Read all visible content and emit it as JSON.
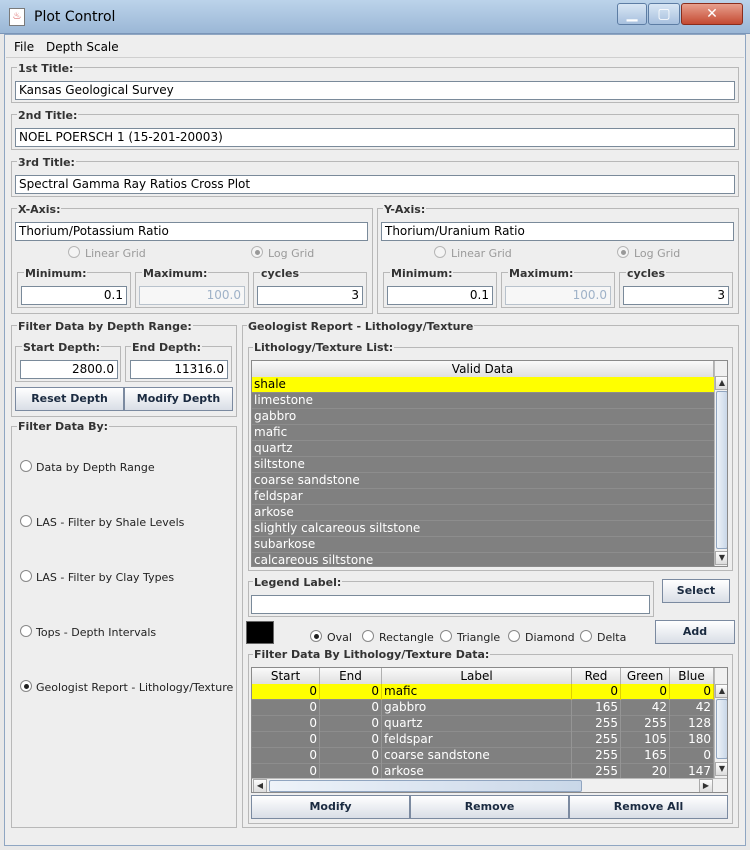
{
  "window": {
    "title": "Plot Control",
    "app_icon": "java-cup-icon",
    "minimize": "▁",
    "maximize": "▢",
    "close": "✕"
  },
  "menu": {
    "file": "File",
    "depth_scale": "Depth Scale"
  },
  "titles": {
    "t1_label": "1st Title:",
    "t1_value": "Kansas Geological Survey",
    "t2_label": "2nd Title:",
    "t2_value": "NOEL POERSCH 1 (15-201-20003)",
    "t3_label": "3rd Title:",
    "t3_value": "Spectral Gamma Ray Ratios Cross Plot"
  },
  "xaxis": {
    "label": "X-Axis:",
    "value": "Thorium/Potassium Ratio",
    "linear": "Linear Grid",
    "log": "Log Grid",
    "grid": "log",
    "min_label": "Minimum:",
    "min": "0.1",
    "max_label": "Maximum:",
    "max": "100.0",
    "cycles_label": "cycles",
    "cycles": "3"
  },
  "yaxis": {
    "label": "Y-Axis:",
    "value": "Thorium/Uranium Ratio",
    "linear": "Linear Grid",
    "log": "Log Grid",
    "grid": "log",
    "min_label": "Minimum:",
    "min": "0.1",
    "max_label": "Maximum:",
    "max": "100.0",
    "cycles_label": "cycles",
    "cycles": "3"
  },
  "depth": {
    "label": "Filter Data by Depth Range:",
    "start_label": "Start Depth:",
    "start": "2800.0",
    "end_label": "End Depth:",
    "end": "11316.0",
    "reset": "Reset Depth",
    "modify": "Modify Depth"
  },
  "filter_by": {
    "label": "Filter Data By:",
    "selected": 4,
    "options": [
      "Data by Depth Range",
      "LAS - Filter by Shale Levels",
      "LAS - Filter by Clay Types",
      "Tops - Depth Intervals",
      "Geologist Report - Lithology/Texture"
    ]
  },
  "geo": {
    "label": "Geologist Report - Lithology/Texture",
    "list_label": "Lithology/Texture List:",
    "list_header": "Valid Data",
    "list_items": [
      "shale",
      "limestone",
      "gabbro",
      "mafic",
      "quartz",
      "siltstone",
      "coarse sandstone",
      "feldspar",
      "arkose",
      "slightly calcareous siltstone",
      "subarkose",
      "calcareous siltstone"
    ],
    "legend_label": "Legend Label:",
    "legend_value": "",
    "select": "Select",
    "add": "Add",
    "symbol_color": "#000000",
    "shapes": [
      "Oval",
      "Rectangle",
      "Triangle",
      "Diamond",
      "Delta"
    ],
    "shape_selected": 0,
    "table_label": "Filter Data By Lithology/Texture Data:",
    "columns": [
      "Start",
      "End",
      "Label",
      "Red",
      "Green",
      "Blue"
    ],
    "rows": [
      {
        "start": "0",
        "end": "0",
        "label": "mafic",
        "red": "0",
        "green": "0",
        "blue": "0"
      },
      {
        "start": "0",
        "end": "0",
        "label": "gabbro",
        "red": "165",
        "green": "42",
        "blue": "42"
      },
      {
        "start": "0",
        "end": "0",
        "label": "quartz",
        "red": "255",
        "green": "255",
        "blue": "128"
      },
      {
        "start": "0",
        "end": "0",
        "label": "feldspar",
        "red": "255",
        "green": "105",
        "blue": "180"
      },
      {
        "start": "0",
        "end": "0",
        "label": "coarse sandstone",
        "red": "255",
        "green": "165",
        "blue": "0"
      },
      {
        "start": "0",
        "end": "0",
        "label": "arkose",
        "red": "255",
        "green": "20",
        "blue": "147"
      }
    ],
    "modify": "Modify",
    "remove": "Remove",
    "remove_all": "Remove All"
  },
  "colors": {
    "highlight": "#ffff00",
    "row_bg": "#808080"
  }
}
